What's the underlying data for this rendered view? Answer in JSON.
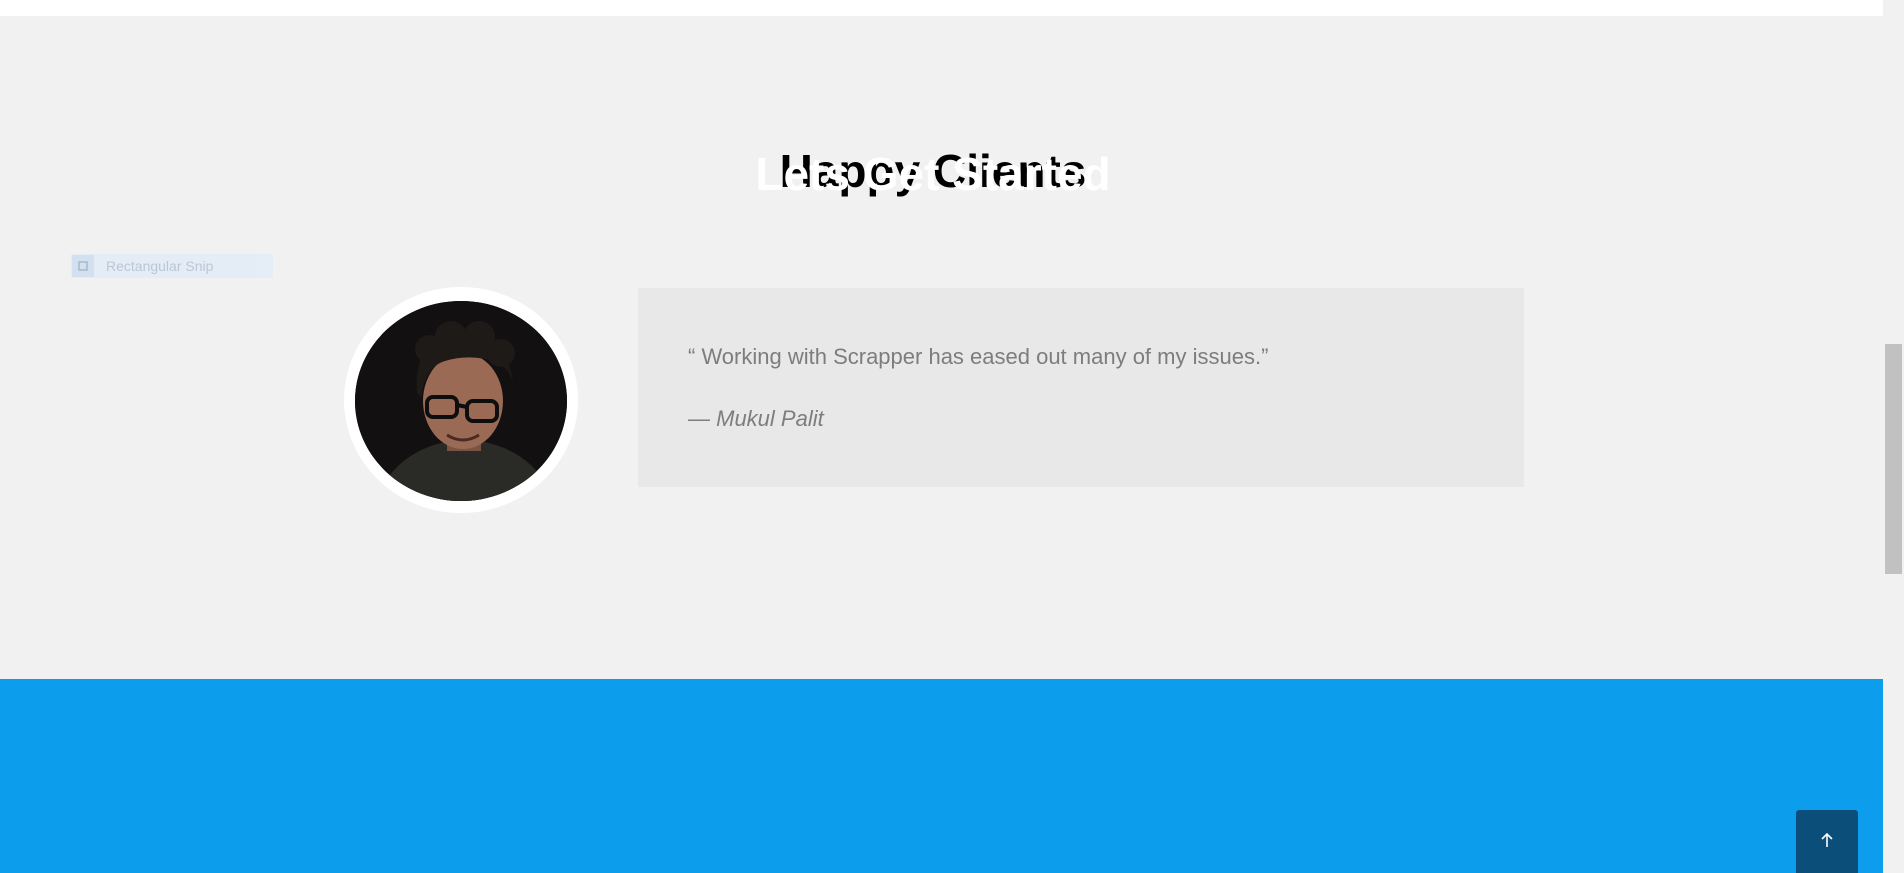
{
  "clients": {
    "title": "Happy Clients",
    "testimonial": {
      "quote": "“ Working with Scrapper has eased out many of my issues.”",
      "author": "— Mukul Palit"
    }
  },
  "snip_overlay": {
    "label": "Rectangular Snip",
    "icon": "snip-icon"
  },
  "cta": {
    "title": "Lets Get Started"
  },
  "back_to_top": {
    "icon": "arrow-up-icon"
  },
  "colors": {
    "section_bg": "#f1f1f1",
    "quote_bg": "#e8e8e8",
    "cta_bg": "#0c9ded",
    "back_to_top_bg": "#0b4e7a"
  }
}
